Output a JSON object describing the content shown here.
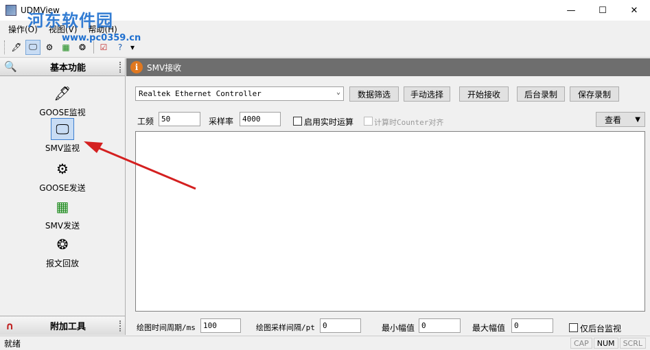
{
  "window": {
    "title": "UDMView",
    "controls": {
      "minimize": "—",
      "maximize": "☐",
      "close": "✕"
    }
  },
  "watermark": {
    "text": "河东软件园",
    "url": "www.pc0359.cn"
  },
  "menu": [
    "操作(O)",
    "视图(V)",
    "帮助(H)"
  ],
  "toolbar": {
    "icons": [
      "goose-monitor-icon",
      "smv-monitor-icon",
      "goose-send-icon",
      "smv-send-icon",
      "playback-icon",
      "checklist-icon",
      "help-icon"
    ],
    "overflow": "▾"
  },
  "left_panel": {
    "title": "基本功能",
    "items": [
      {
        "label": "GOOSE监视",
        "icon": "goose-monitor-icon"
      },
      {
        "label": "SMV监视",
        "icon": "smv-monitor-icon",
        "selected": true
      },
      {
        "label": "GOOSE发送",
        "icon": "goose-send-icon"
      },
      {
        "label": "SMV发送",
        "icon": "smv-send-icon"
      },
      {
        "label": "报文回放",
        "icon": "playback-icon"
      }
    ],
    "footer_title": "附加工具"
  },
  "smv_panel": {
    "title": "SMV接收",
    "adapter": "Realtek Ethernet Controller",
    "buttons": {
      "filter": "数据筛选",
      "manual_select": "手动选择",
      "start_receive": "开始接收",
      "bg_record": "后台录制",
      "save_record": "保存录制",
      "view": "查看"
    },
    "freq_label": "工频",
    "freq_value": "50",
    "sample_rate_label": "采样率",
    "sample_rate_value": "4000",
    "realtime_label": "启用实时运算",
    "counter_label": "计算时Counter对齐",
    "draw_period_label": "绘图时间周期/ms",
    "draw_period_value": "100",
    "draw_interval_label": "绘图采样间隔/pt",
    "draw_interval_value": "0",
    "min_amp_label": "最小幅值",
    "min_amp_value": "0",
    "max_amp_label": "最大幅值",
    "max_amp_value": "0",
    "bg_monitor_label": "仅后台监视"
  },
  "status": {
    "text": "就绪",
    "indicators": [
      "CAP",
      "NUM",
      "SCRL"
    ]
  },
  "colors": {
    "annotation_arrow": "#d42020",
    "panel_header": "#6e6e6e",
    "info_icon": "#e07820"
  }
}
